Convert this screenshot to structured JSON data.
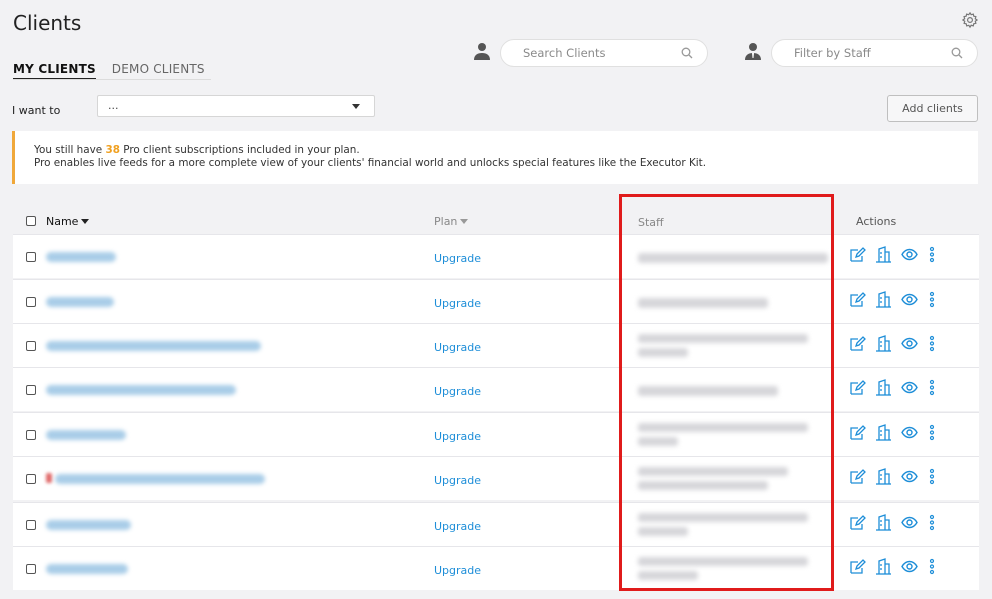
{
  "header": {
    "title": "Clients"
  },
  "tabs": [
    {
      "label": "MY CLIENTS",
      "active": true
    },
    {
      "label": "DEMO CLIENTS",
      "active": false
    }
  ],
  "search": {
    "placeholder": "Search Clients"
  },
  "staff_filter": {
    "placeholder": "Filter by Staff"
  },
  "actions_bar": {
    "label": "I want to",
    "selected": "...",
    "add_label": "Add clients"
  },
  "notice": {
    "pre": "You still have ",
    "count": "38",
    "post": " Pro client subscriptions included in your plan.",
    "line2": "Pro enables live feeds for a more complete view of your clients' financial world and unlocks special features like the Executor Kit."
  },
  "table": {
    "columns": {
      "name": "Name",
      "plan": "Plan",
      "staff": "Staff",
      "actions": "Actions"
    },
    "rows": [
      {
        "plan": "Upgrade"
      },
      {
        "plan": "Upgrade"
      },
      {
        "plan": "Upgrade"
      },
      {
        "plan": "Upgrade"
      },
      {
        "plan": "Upgrade"
      },
      {
        "plan": "Upgrade"
      },
      {
        "plan": "Upgrade"
      },
      {
        "plan": "Upgrade"
      }
    ]
  },
  "colors": {
    "accent": "#1e8ed8",
    "warning": "#f0a83a",
    "highlight": "#e01b1b"
  },
  "icons": [
    "gear-icon",
    "person-icon",
    "search-icon",
    "edit-icon",
    "building-icon",
    "eye-icon",
    "more-vertical-icon"
  ]
}
